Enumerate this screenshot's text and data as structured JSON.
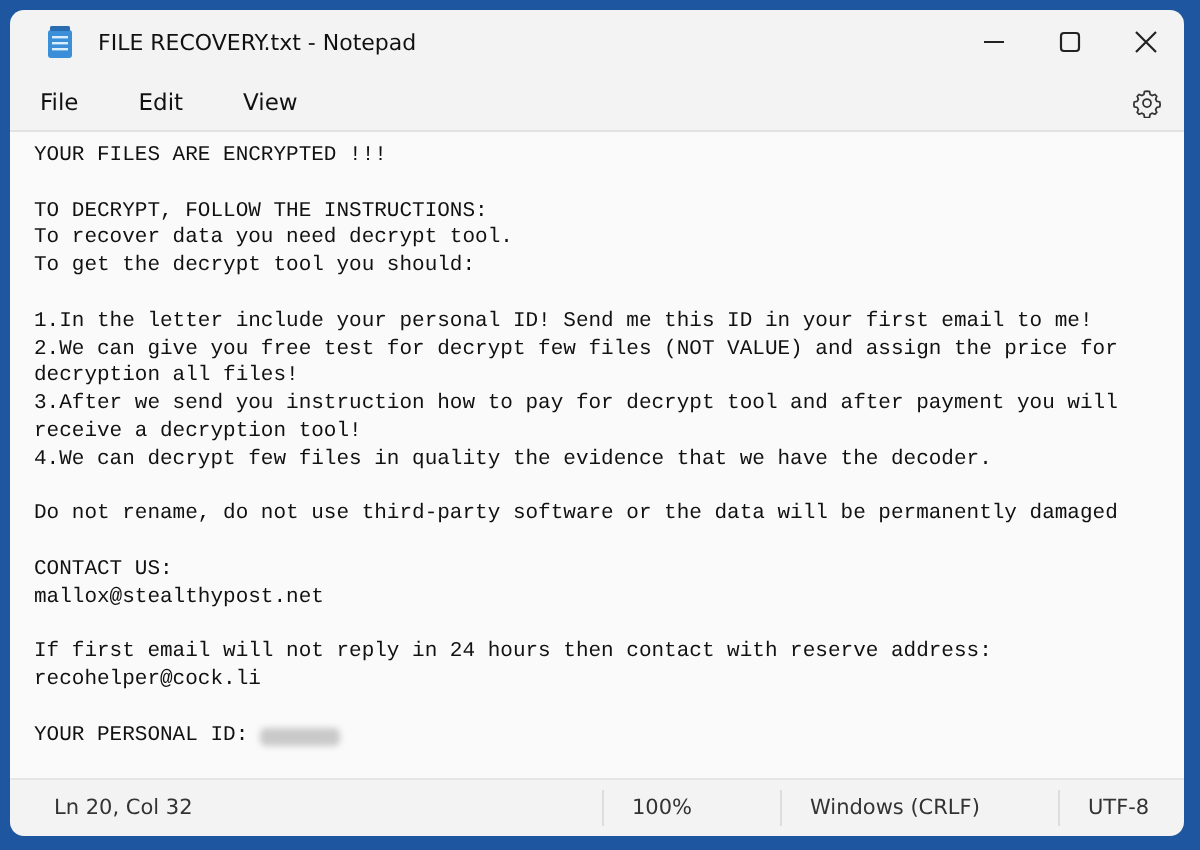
{
  "window": {
    "title": "FILE RECOVERY.txt - Notepad"
  },
  "menu": [
    "File",
    "Edit",
    "View"
  ],
  "editor": {
    "paragraphs": [
      {
        "lines": [
          "YOUR FILES ARE ENCRYPTED !!!"
        ]
      },
      {
        "lines": [
          "TO DECRYPT, FOLLOW THE INSTRUCTIONS:",
          "To recover data you need decrypt tool.",
          "To get the decrypt tool you should:"
        ]
      },
      {
        "lines": [
          "1.In the letter include your personal ID! Send me this ID in your first email to me!",
          "2.We can give you free test for decrypt few files (NOT VALUE) and assign the price for decryption all files!",
          "3.After we send you instruction how to pay for decrypt tool and after payment you will receive a decryption tool!",
          "4.We can decrypt few files in quality the evidence that we have the decoder."
        ]
      },
      {
        "lines": [
          "Do not rename, do not use third-party software or the data will be permanently damaged"
        ]
      },
      {
        "lines": [
          "CONTACT US:",
          "mallox@stealthypost.net"
        ]
      },
      {
        "lines": [
          "If first email will not reply in 24 hours then contact with reserve address:",
          "recohelper@cock.li"
        ]
      },
      {
        "lines": [
          "YOUR PERSONAL ID: "
        ],
        "redacted": true
      }
    ]
  },
  "status_bar": {
    "position": "Ln 20, Col 32",
    "zoom": "100%",
    "line_ending": "Windows (CRLF)",
    "encoding": "UTF-8"
  }
}
